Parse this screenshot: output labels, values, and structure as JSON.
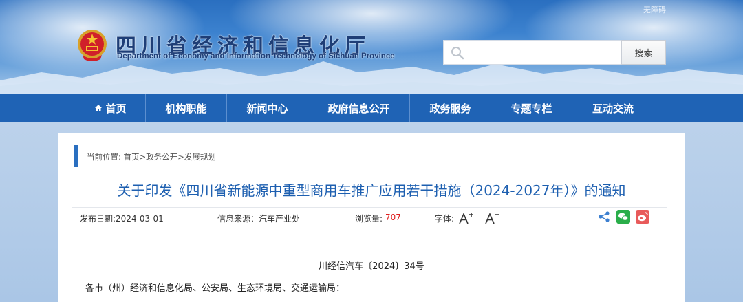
{
  "header": {
    "accessibility_label": "无障碍",
    "site_name_cn": "四川省经济和信息化厅",
    "site_name_en": "Department of Economy and Information Technology of Sichuan Province",
    "search_placeholder": "",
    "search_button": "搜索",
    "emblem_icon": "national-emblem-icon"
  },
  "nav": {
    "items": [
      {
        "label": "首页",
        "icon": "home-icon"
      },
      {
        "label": "机构职能"
      },
      {
        "label": "新闻中心"
      },
      {
        "label": "政府信息公开"
      },
      {
        "label": "政务服务"
      },
      {
        "label": "专题专栏"
      },
      {
        "label": "互动交流"
      }
    ],
    "bg_color": "#1f63b5"
  },
  "article": {
    "breadcrumb": "当前位置: 首页>政务公开>发展规划",
    "title": "关于印发《四川省新能源中重型商用车推广应用若干措施（2024-2027年）》的通知",
    "meta": {
      "publish_date": "发布日期:2024-03-01",
      "source": "信息来源：汽车产业处",
      "views_label": "浏览量:",
      "views_value": "707",
      "font_label": "字体:",
      "font_larger": "A+",
      "font_smaller": "A-"
    },
    "share_icons": [
      "share-icon",
      "wechat-icon",
      "weibo-icon"
    ],
    "document_number": "川经信汽车〔2024〕34号",
    "addressee": "各市（州）经济和信息化局、公安局、生态环境局、交通运输局："
  },
  "colors": {
    "accent": "#1d5fb0",
    "views_red": "#e02020",
    "wechat_green": "#2aae4a",
    "weibo_red": "#e85a5a"
  }
}
